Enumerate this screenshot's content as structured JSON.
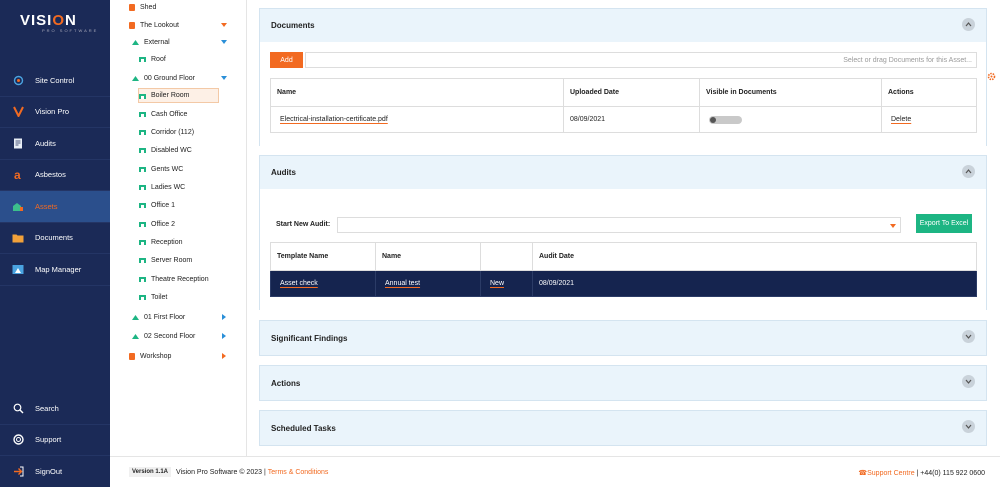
{
  "brand": {
    "name_pre": "VISI",
    "name_o": "O",
    "name_post": "N",
    "tagline": "PRO SOFTWARE"
  },
  "nav": [
    {
      "label": "Site Control",
      "icon": "site-control-icon",
      "active": false
    },
    {
      "label": "Vision Pro",
      "icon": "vision-pro-icon",
      "active": false
    },
    {
      "label": "Audits",
      "icon": "audits-icon",
      "active": false
    },
    {
      "label": "Asbestos",
      "icon": "asbestos-icon",
      "active": false
    },
    {
      "label": "Assets",
      "icon": "assets-icon",
      "active": true
    },
    {
      "label": "Documents",
      "icon": "documents-icon",
      "active": false
    },
    {
      "label": "Map Manager",
      "icon": "map-manager-icon",
      "active": false
    }
  ],
  "nav_bottom": [
    {
      "label": "Search",
      "icon": "search-icon"
    },
    {
      "label": "Support",
      "icon": "support-icon"
    },
    {
      "label": "SignOut",
      "icon": "signout-icon"
    }
  ],
  "tree": {
    "shed": "Shed",
    "lookout": "The Lookout",
    "external": "External",
    "roof": "Roof",
    "ground": "00 Ground Floor",
    "rooms": [
      "Boiler Room",
      "Cash Office",
      "Corridor (112)",
      "Disabled WC",
      "Gents WC",
      "Ladies WC",
      "Office 1",
      "Office 2",
      "Reception",
      "Server Room",
      "Theatre Reception",
      "Toilet"
    ],
    "first": "01 First Floor",
    "second": "02 Second Floor",
    "workshop": "Workshop"
  },
  "documents": {
    "title": "Documents",
    "add_label": "Add",
    "placeholder": "Select or drag Documents for this Asset...",
    "headers": [
      "Name",
      "Uploaded Date",
      "Visible in Documents",
      "Actions"
    ],
    "row": {
      "name": "Electrical-installation-certificate.pdf",
      "date": "08/09/2021",
      "action": "Delete"
    }
  },
  "audits": {
    "title": "Audits",
    "start_label": "Start New Audit:",
    "export_label": "Export To Excel",
    "headers": [
      "Template Name",
      "Name",
      "",
      "Audit Date"
    ],
    "row": {
      "template": "Asset check",
      "name": "Annual test",
      "status": "New",
      "date": "08/09/2021"
    }
  },
  "sections": {
    "findings": "Significant Findings",
    "actions": "Actions",
    "tasks": "Scheduled Tasks"
  },
  "footer": {
    "version": "Version 1.1A",
    "copyright": "Vision Pro Software © 2023 |",
    "terms": "Terms & Conditions",
    "support": "Support Centre",
    "phone": "| +44(0) 115 922 0600"
  },
  "colors": {
    "accent": "#f26a21",
    "sidebar": "#1b2a57",
    "export": "#1db583",
    "active_row": "#15244f"
  }
}
